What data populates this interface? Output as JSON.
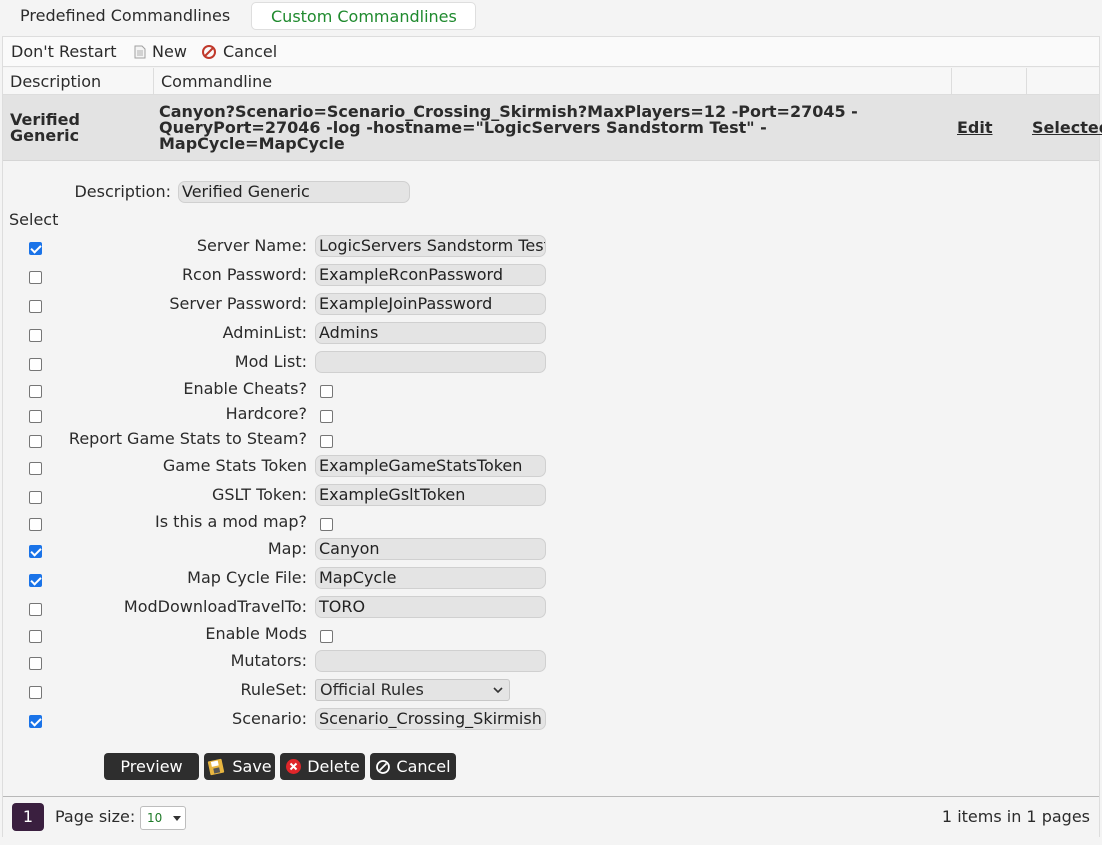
{
  "tabs": [
    {
      "label": "Predefined Commandlines",
      "active": false
    },
    {
      "label": "Custom Commandlines",
      "active": true
    }
  ],
  "toolbar": {
    "dont_restart": "Don't Restart",
    "new": "New",
    "cancel": "Cancel"
  },
  "grid": {
    "headers": [
      "Description",
      "Commandline",
      "",
      ""
    ],
    "row": {
      "description": "Verified Generic",
      "commandline": "Canyon?Scenario=Scenario_Crossing_Skirmish?MaxPlayers=12 -Port=27045 - QueryPort=27046 -log -hostname=\"LogicServers Sandstorm Test\" - MapCycle=MapCycle",
      "edit": "Edit",
      "selected": "Selected"
    }
  },
  "form": {
    "description_label": "Description:",
    "description_value": "Verified Generic",
    "select_heading": "Select",
    "fields": [
      {
        "label": "Server Name:",
        "type": "text",
        "value": "LogicServers Sandstorm Test",
        "selected": true
      },
      {
        "label": "Rcon Password:",
        "type": "text",
        "value": "ExampleRconPassword",
        "selected": false
      },
      {
        "label": "Server Password:",
        "type": "text",
        "value": "ExampleJoinPassword",
        "selected": false
      },
      {
        "label": "AdminList:",
        "type": "text",
        "value": "Admins",
        "selected": false
      },
      {
        "label": "Mod List:",
        "type": "text",
        "value": "",
        "selected": false
      },
      {
        "label": "Enable Cheats?",
        "type": "check",
        "checked": false,
        "selected": false
      },
      {
        "label": "Hardcore?",
        "type": "check",
        "checked": false,
        "selected": false
      },
      {
        "label": "Report Game Stats to Steam?",
        "type": "check",
        "checked": false,
        "selected": false
      },
      {
        "label": "Game Stats Token",
        "type": "text",
        "value": "ExampleGameStatsToken",
        "selected": false
      },
      {
        "label": "GSLT Token:",
        "type": "text",
        "value": "ExampleGsltToken",
        "selected": false
      },
      {
        "label": "Is this a mod map?",
        "type": "check",
        "checked": false,
        "selected": false
      },
      {
        "label": "Map:",
        "type": "text",
        "value": "Canyon",
        "selected": true
      },
      {
        "label": "Map Cycle File:",
        "type": "text",
        "value": "MapCycle",
        "selected": true
      },
      {
        "label": "ModDownloadTravelTo:",
        "type": "text",
        "value": "TORO",
        "selected": false
      },
      {
        "label": "Enable Mods",
        "type": "check",
        "checked": false,
        "selected": false
      },
      {
        "label": "Mutators:",
        "type": "text",
        "value": "",
        "selected": false
      },
      {
        "label": "RuleSet:",
        "type": "select",
        "value": "Official Rules",
        "selected": false
      },
      {
        "label": "Scenario:",
        "type": "text",
        "value": "Scenario_Crossing_Skirmish",
        "selected": true
      }
    ],
    "buttons": {
      "preview": "Preview",
      "save": "Save",
      "delete": "Delete",
      "cancel": "Cancel"
    }
  },
  "pager": {
    "page": "1",
    "page_size_label": "Page size:",
    "page_size": "10",
    "summary": "1 items in 1 pages"
  }
}
